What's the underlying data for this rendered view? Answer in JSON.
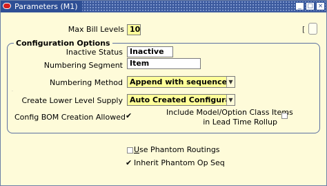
{
  "window": {
    "title": "Parameters (M1)",
    "controls": [
      "_",
      "□",
      "×"
    ]
  },
  "max_bill_levels": {
    "label": "Max Bill Levels",
    "value": "10"
  },
  "descriptive_flex": {
    "open": "[",
    "close": "]"
  },
  "config_options": {
    "title": "Configuration Options",
    "inactive_status": {
      "label": "Inactive Status",
      "value": "Inactive"
    },
    "numbering_segment": {
      "label": "Numbering Segment",
      "value": "Item"
    },
    "numbering_method": {
      "label": "Numbering Method",
      "value": "Append with sequence"
    },
    "create_lower_level_supply": {
      "label": "Create Lower Level Supply",
      "value": "Auto Created Configuration It..."
    },
    "config_bom_creation_allowed": {
      "label": "Config BOM Creation Allowed",
      "checked": true
    },
    "include_model_option": {
      "label_line1": "Include Model/Option Class Items",
      "label_line2": "in Lead Time Rollup",
      "checked": false
    }
  },
  "use_phantom_routings": {
    "mnemonic": "U",
    "label_rest": "se Phantom Routings",
    "checked": false
  },
  "inherit_phantom_op_seq": {
    "label": "Inherit Phantom Op Seq",
    "checked": true
  },
  "icons": {
    "dropdown": "▼",
    "check": "✔"
  }
}
